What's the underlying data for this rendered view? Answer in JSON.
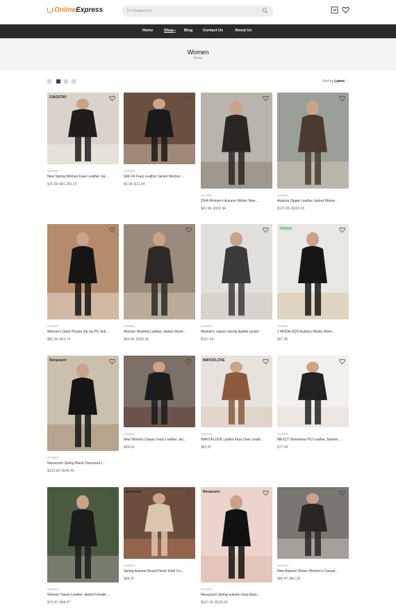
{
  "header": {
    "logo_part1": "Online",
    "logo_part2": "Express",
    "search_placeholder": "I'm shopping for ..."
  },
  "nav": [
    {
      "label": "Home"
    },
    {
      "label": "Shop",
      "active": true
    },
    {
      "label": "Blog"
    },
    {
      "label": "Contact Us"
    },
    {
      "label": "About Us"
    }
  ],
  "page": {
    "title": "Women",
    "breadcrumb": "Home"
  },
  "toolbar": {
    "sort_prefix": "Sort by",
    "sort_value": "Latest"
  },
  "products": [
    {
      "category": "WOMEN",
      "title": "New Spring Woman Faux Leather Jac...",
      "price": "$76.99–$41,281.57",
      "brand": "CIAOSTAY"
    },
    {
      "category": "WOMEN",
      "title": "Slim Fit Faux Leather Jacket Women ...",
      "price": "$6.94–$12.64",
      "brand": ""
    },
    {
      "category": "WOMEN",
      "title": "ZIKA Women's Autumn Winter New ...",
      "price": "$91.96–$102.94",
      "brand": ""
    },
    {
      "category": "WOMEN",
      "title": "Autumn Zipper Leather Jacket Wome...",
      "price": "$121.65–$126.93",
      "brand": ""
    },
    {
      "category": "WOMEN",
      "title": "Women's Slant Pocket Zip Up PU Soli...",
      "price": "$50.35–$53.74",
      "brand": ""
    },
    {
      "category": "WOMEN",
      "title": "Women Washed Leather Jacket Street...",
      "price": "$92.95–$100.06",
      "brand": ""
    },
    {
      "category": "WOMEN",
      "title": "Women's classic trendy leather jacket",
      "price": "$107.34",
      "brand": ""
    },
    {
      "category": "WOMEN",
      "title": "1 MODA 2023 Autumn Winter Wom...",
      "price": "$57.36",
      "brand": "TMODA"
    },
    {
      "category": "WOMEN",
      "title": "Nerazzurri Spring Black Oversized l...",
      "price": "$129.60–$140.40",
      "brand": "Nerazzurri"
    },
    {
      "category": "WOMEN",
      "title": "New Women Classic Faux Leather Jac...",
      "price": "$84.63",
      "brand": ""
    },
    {
      "category": "WOMEN",
      "title": "WAYOFLOVE Ladies Faux Deer Leath...",
      "price": "$62.97",
      "brand": "WAYOFLOVE"
    },
    {
      "category": "WOMEN",
      "title": "MEXZT Streetwear PU Leather Jackets ...",
      "price": "$77.49",
      "brand": ""
    },
    {
      "category": "WOMEN",
      "title": "Women Tassel Leather Jacket Female ...",
      "price": "$79.47–$98.07",
      "brand": ""
    },
    {
      "category": "WOMEN",
      "title": "Spring Autumn Round Neck Solid Co...",
      "price": "$68.07",
      "brand": "girlmoral"
    },
    {
      "category": "WOMEN",
      "title": "Nerazzurri Spring autumn long black...",
      "price": "$117.00–$126.20",
      "brand": "Nerazzurri"
    },
    {
      "category": "WOMEN",
      "title": "New Autumn Winter Women's Casual...",
      "price": "$56.47–$61.30",
      "brand": ""
    }
  ],
  "colors": {
    "accent": "#e7892a",
    "nav_bg": "#2a2a2a",
    "page_head_bg": "#f3f3f3"
  }
}
